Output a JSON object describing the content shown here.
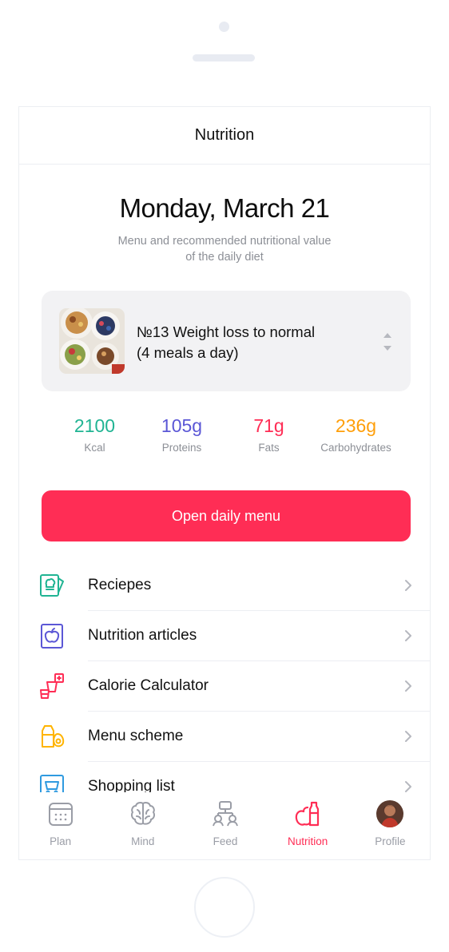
{
  "header": {
    "title": "Nutrition"
  },
  "day": {
    "title": "Monday, March 21",
    "subtitle_line1": "Menu and recommended nutritional value",
    "subtitle_line2": "of the daily diet"
  },
  "plan": {
    "line1": "№13 Weight loss to normal",
    "line2": "(4 meals a day)"
  },
  "macros": [
    {
      "value": "2100",
      "label": "Kcal",
      "color": "#20b493"
    },
    {
      "value": "105g",
      "label": "Proteins",
      "color": "#5b57d6"
    },
    {
      "value": "71g",
      "label": "Fats",
      "color": "#ff2d55"
    },
    {
      "value": "236g",
      "label": "Carbohydrates",
      "color": "#ff9f0a"
    }
  ],
  "cta": {
    "label": "Open daily menu",
    "color": "#ff2d55"
  },
  "menu": [
    {
      "label": "Reciepes",
      "icon": "chef-hat-icon",
      "color": "#20b493"
    },
    {
      "label": "Nutrition articles",
      "icon": "apple-article-icon",
      "color": "#5b57d6"
    },
    {
      "label": "Calorie Calculator",
      "icon": "calculator-cups-icon",
      "color": "#ff2d55"
    },
    {
      "label": "Menu scheme",
      "icon": "milk-avocado-icon",
      "color": "#ffb400"
    },
    {
      "label": "Shopping list",
      "icon": "basket-icon",
      "color": "#2f9ae0"
    }
  ],
  "tabs": [
    {
      "label": "Plan",
      "icon": "calendar-icon"
    },
    {
      "label": "Mind",
      "icon": "brain-icon"
    },
    {
      "label": "Feed",
      "icon": "feed-icon"
    },
    {
      "label": "Nutrition",
      "icon": "nutrition-icon",
      "active": true
    },
    {
      "label": "Profile",
      "icon": "avatar"
    }
  ]
}
